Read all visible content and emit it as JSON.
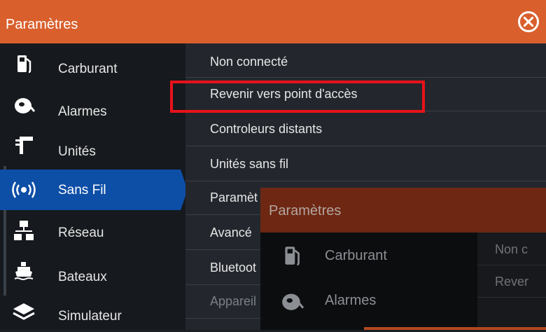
{
  "header": {
    "title": "Paramètres",
    "close_icon": "close-circle-icon"
  },
  "sidebar": {
    "items": [
      {
        "label": "Carburant",
        "icon": "fuel-pump-icon",
        "active": false
      },
      {
        "label": "Alarmes",
        "icon": "alarm-bell-icon",
        "active": false
      },
      {
        "label": "Unités",
        "icon": "units-ruler-icon",
        "active": false
      },
      {
        "label": "Sans Fil",
        "icon": "wireless-icon",
        "active": true
      },
      {
        "label": "Réseau",
        "icon": "network-icon",
        "active": false
      },
      {
        "label": "Bateaux",
        "icon": "boat-icon",
        "active": false
      },
      {
        "label": "Simulateur",
        "icon": "simulator-layers-icon",
        "active": false
      }
    ]
  },
  "main": {
    "rows": [
      {
        "label": "Non connecté"
      },
      {
        "label": "Revenir vers point d'accès"
      },
      {
        "label": "Controleurs distants"
      },
      {
        "label": "Unités sans fil"
      },
      {
        "label": "Paramèt"
      },
      {
        "label": "Avancé"
      },
      {
        "label": "Bluetoot"
      },
      {
        "label": "Appareil"
      }
    ]
  },
  "overlay": {
    "title": "Paramètres",
    "sidebar": [
      {
        "label": "Carburant",
        "icon": "fuel-pump-icon"
      },
      {
        "label": "Alarmes",
        "icon": "alarm-bell-icon"
      }
    ],
    "rows": [
      {
        "label": "Non c"
      },
      {
        "label": "Rever"
      }
    ]
  },
  "colors": {
    "accent": "#d95f2d",
    "selected": "#0d4ea6",
    "highlight": "#e8121b"
  }
}
